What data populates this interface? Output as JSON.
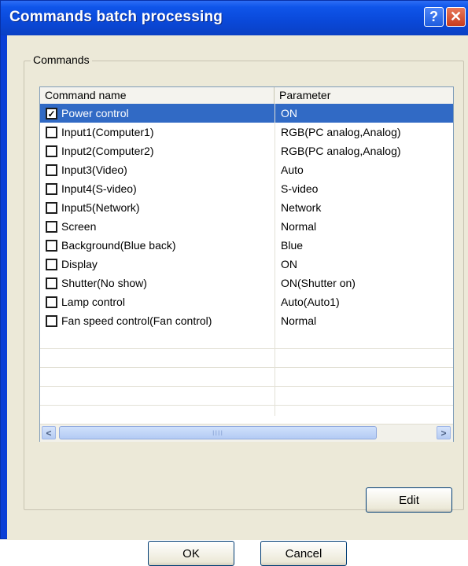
{
  "window": {
    "title": "Commands batch processing",
    "help_glyph": "?",
    "close_glyph": "✕"
  },
  "group": {
    "label": "Commands"
  },
  "table": {
    "columns": [
      "Command name",
      "Parameter"
    ],
    "rows": [
      {
        "name": "Power control",
        "param": "ON",
        "checked": true,
        "selected": true
      },
      {
        "name": "Input1(Computer1)",
        "param": "RGB(PC analog,Analog)",
        "checked": false
      },
      {
        "name": "Input2(Computer2)",
        "param": "RGB(PC analog,Analog)",
        "checked": false
      },
      {
        "name": "Input3(Video)",
        "param": "Auto",
        "checked": false
      },
      {
        "name": "Input4(S-video)",
        "param": "S-video",
        "checked": false
      },
      {
        "name": "Input5(Network)",
        "param": "Network",
        "checked": false
      },
      {
        "name": "Screen",
        "param": "Normal",
        "checked": false
      },
      {
        "name": "Background(Blue back)",
        "param": "Blue",
        "checked": false
      },
      {
        "name": "Display",
        "param": "ON",
        "checked": false
      },
      {
        "name": "Shutter(No show)",
        "param": "ON(Shutter on)",
        "checked": false
      },
      {
        "name": "Lamp control",
        "param": "Auto(Auto1)",
        "checked": false
      },
      {
        "name": "Fan speed control(Fan control)",
        "param": "Normal",
        "checked": false
      }
    ],
    "check_glyph": "✓"
  },
  "scrollbar": {
    "left_arrow": "<",
    "right_arrow": ">",
    "grip": "IIII"
  },
  "buttons": {
    "edit": "Edit",
    "ok": "OK",
    "cancel": "Cancel"
  }
}
